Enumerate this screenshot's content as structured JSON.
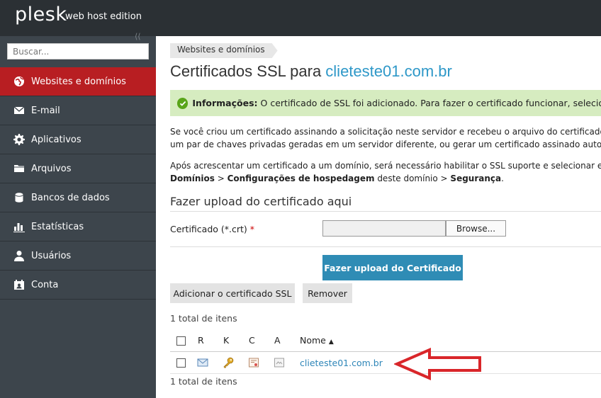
{
  "header": {
    "logo": "plesk",
    "edition": "web host edition"
  },
  "search": {
    "placeholder": "Buscar..."
  },
  "sidebar": {
    "items": [
      {
        "label": "Websites e domínios",
        "icon": "globe-icon",
        "active": true
      },
      {
        "label": "E-mail",
        "icon": "envelope-icon"
      },
      {
        "label": "Aplicativos",
        "icon": "gear-icon"
      },
      {
        "label": "Arquivos",
        "icon": "folder-icon"
      },
      {
        "label": "Bancos de dados",
        "icon": "database-icon"
      },
      {
        "label": "Estatísticas",
        "icon": "bar-chart-icon"
      },
      {
        "label": "Usuários",
        "icon": "user-icon"
      },
      {
        "label": "Conta",
        "icon": "account-icon"
      }
    ]
  },
  "breadcrumb": {
    "label": "Websites e domínios"
  },
  "page": {
    "title_prefix": "Certificados SSL para ",
    "title_domain": "clieteste01.com.br"
  },
  "message": {
    "label": "Informações:",
    "text": "O certificado de SSL foi adicionado. Para fazer o certificado funcionar, selecione-o"
  },
  "paragraphs": {
    "p1_line1": "Se você criou um certificado assinando a solicitação neste servidor e recebeu o arquivo do certificado",
    "p1_line2": "um par de chaves privadas geradas em um servidor diferente, ou gerar um certificado assinado auto",
    "p2_line1": "Após acrescentar um certificado a um domínio, será necessário habilitar o SSL suporte e selecionar e",
    "p2_b1": "Domínios",
    "p2_sep1": " > ",
    "p2_b2": "Configurações de hospedagem",
    "p2_mid": " deste domínio > ",
    "p2_b3": "Segurança",
    "p2_end": "."
  },
  "upload_section": {
    "title": "Fazer upload do certificado aqui",
    "field_label": "Certificado (*.crt)",
    "required_mark": "*",
    "browse_label": "Browse...",
    "submit_label": "Fazer upload do Certificado"
  },
  "toolbar": {
    "add_label": "Adicionar o certificado SSL",
    "remove_label": "Remover"
  },
  "list": {
    "total_top": "1 total de itens",
    "total_bottom": "1 total de itens",
    "columns": {
      "r": "R",
      "k": "K",
      "c": "C",
      "a": "A",
      "name": "Nome"
    },
    "rows": [
      {
        "name": "clieteste01.com.br"
      }
    ]
  },
  "colors": {
    "accent": "#2e98c8",
    "active_nav": "#b81e22",
    "sidebar": "#3d454c",
    "success_bg": "#d6ecc0",
    "annotation_arrow": "#d9262a"
  }
}
